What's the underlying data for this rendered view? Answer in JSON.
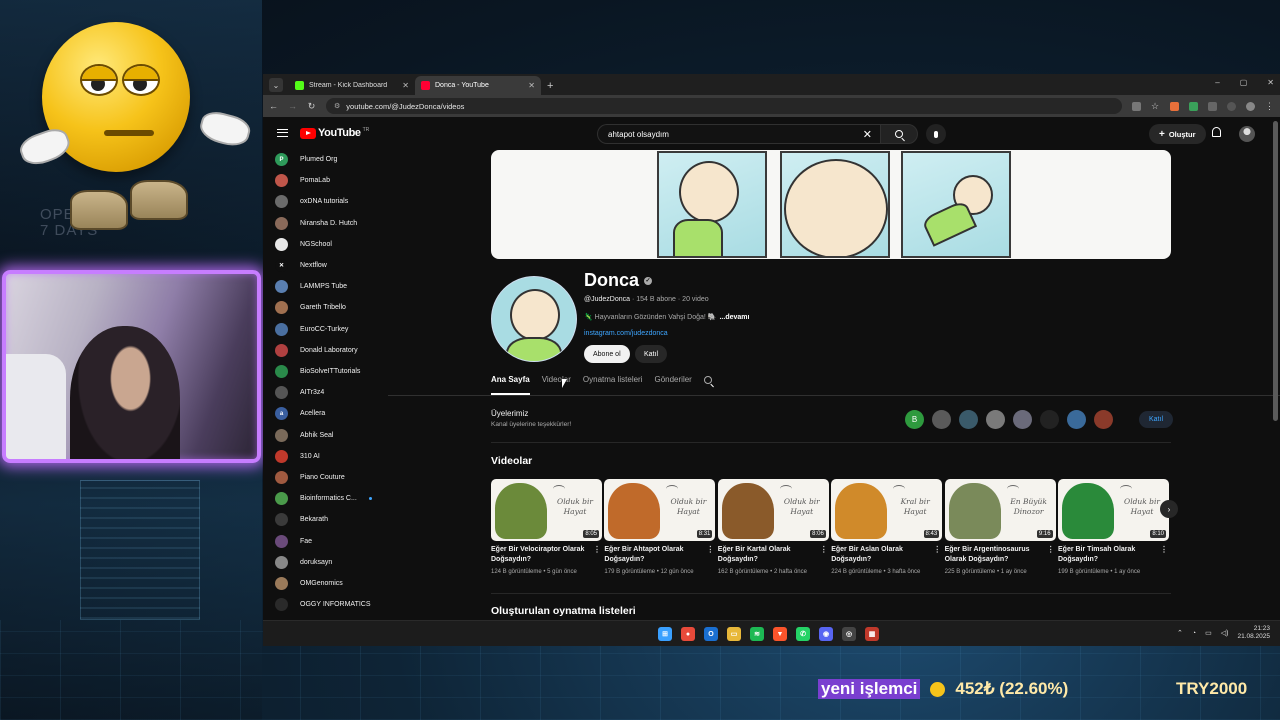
{
  "overlay": {
    "open_text_1": "OPE",
    "open_text_2": "7 DAYS",
    "ticker_highlight": "yeni işlemci",
    "ticker_value": "452₺ (22.60%)",
    "ticker_right": "TRY2000"
  },
  "browser": {
    "tabs": [
      {
        "label": "Stream - Kick Dashboard",
        "favicon_color": "#53fc18",
        "active": false
      },
      {
        "label": "Donca - YouTube",
        "favicon_color": "#ff0033",
        "active": true
      }
    ],
    "url": "youtube.com/@JudezDonca/videos",
    "window_controls": [
      "–",
      "▢",
      "✕"
    ]
  },
  "youtube": {
    "logo_text": "YouTube",
    "logo_sup": "TR",
    "search_value": "ahtapot olsaydım",
    "create_label": "Oluştur",
    "sidebar": [
      {
        "label": "Plumed Org",
        "color": "#2e9a5a",
        "initial": "P"
      },
      {
        "label": "PomaLab",
        "color": "#c0564a",
        "initial": ""
      },
      {
        "label": "oxDNA tutorials",
        "color": "#6b6b6b",
        "initial": ""
      },
      {
        "label": "Niransha D. Hutch",
        "color": "#8a6a5a",
        "initial": ""
      },
      {
        "label": "NGSchool",
        "color": "#e8e8e8",
        "initial": ""
      },
      {
        "label": "Nextflow",
        "color": "#0f0f0f",
        "initial": "✕"
      },
      {
        "label": "LAMMPS Tube",
        "color": "#5a7fb0",
        "initial": ""
      },
      {
        "label": "Gareth Tribello",
        "color": "#a07050",
        "initial": ""
      },
      {
        "label": "EuroCC-Turkey",
        "color": "#4a6fa0",
        "initial": ""
      },
      {
        "label": "Donald Laboratory",
        "color": "#b04040",
        "initial": ""
      },
      {
        "label": "BioSolveITTutorials",
        "color": "#2a8a4a",
        "initial": ""
      },
      {
        "label": "AITr3z4",
        "color": "#555",
        "initial": ""
      },
      {
        "label": "Acellera",
        "color": "#3a5fa0",
        "initial": "a"
      },
      {
        "label": "Abhik Seal",
        "color": "#7a6a5a",
        "initial": ""
      },
      {
        "label": "310 AI",
        "color": "#c0392b",
        "initial": ""
      },
      {
        "label": "Piano Couture",
        "color": "#a05a40",
        "initial": ""
      },
      {
        "label": "Bioinformatics C...",
        "color": "#4a9a4a",
        "initial": "",
        "new": true
      },
      {
        "label": "Bekarath",
        "color": "#3a3a3a",
        "initial": ""
      },
      {
        "label": "Fae",
        "color": "#6a4a7a",
        "initial": ""
      },
      {
        "label": "doruksayn",
        "color": "#888",
        "initial": ""
      },
      {
        "label": "OMGenomics",
        "color": "#9a7a5a",
        "initial": ""
      },
      {
        "label": "OGGY INFORMATICS",
        "color": "#2a2a2a",
        "initial": ""
      }
    ],
    "channel": {
      "name": "Donca",
      "handle": "@JudezDonca",
      "meta": " · 154 B abone · 20 video",
      "description": "🦎 Hayvanların Gözünden Vahşi Doğa! 🐘",
      "more": "...devamı",
      "link": "instagram.com/judezdonca",
      "subscribe_label": "Abone ol",
      "join_label": "Katıl"
    },
    "channel_tabs": [
      "Ana Sayfa",
      "Videolar",
      "Oynatma listeleri",
      "Gönderiler"
    ],
    "active_tab_index": 0,
    "members": {
      "title": "Üyelerimiz",
      "subtitle": "Kanal üyelerine teşekkürler!",
      "join_label": "Katıl",
      "avatars": [
        {
          "initial": "B",
          "color": "#2e9a3e"
        },
        {
          "initial": "",
          "color": "#5a5a5a"
        },
        {
          "initial": "",
          "color": "#3a5a6a"
        },
        {
          "initial": "",
          "color": "#7a7a7a"
        },
        {
          "initial": "",
          "color": "#6a6a7a"
        },
        {
          "initial": "",
          "color": "#222"
        },
        {
          "initial": "",
          "color": "#3a6a9a"
        },
        {
          "initial": "",
          "color": "#8a3a2a"
        }
      ]
    },
    "videos_title": "Videolar",
    "videos": [
      {
        "title": "Eğer Bir Velociraptor Olarak Doğsaydın?",
        "views": "124 B görüntüleme",
        "age": "5 gün önce",
        "duration": "8:05",
        "hand_text": "Olduk bir Hayat",
        "creature_color": "#6b8a3a"
      },
      {
        "title": "Eğer Bir Ahtapot Olarak Doğsaydın?",
        "views": "179 B görüntüleme",
        "age": "12 gün önce",
        "duration": "8:31",
        "hand_text": "Olduk bir Hayat",
        "creature_color": "#c06a2a"
      },
      {
        "title": "Eğer Bir Kartal Olarak Doğsaydın?",
        "views": "162 B görüntüleme",
        "age": "2 hafta önce",
        "duration": "8:06",
        "hand_text": "Olduk bir Hayat",
        "creature_color": "#8a5a2a"
      },
      {
        "title": "Eğer Bir Aslan Olarak Doğsaydın?",
        "views": "224 B görüntüleme",
        "age": "3 hafta önce",
        "duration": "8:43",
        "hand_text": "Kral bir Hayat",
        "creature_color": "#d08a2a"
      },
      {
        "title": "Eğer Bir Argentinosaurus Olarak Doğsaydın?",
        "views": "225 B görüntüleme",
        "age": "1 ay önce",
        "duration": "9:16",
        "hand_text": "En Büyük Dinozor",
        "creature_color": "#7a8a5a"
      },
      {
        "title": "Eğer Bir Timsah Olarak Doğsaydın?",
        "views": "199 B görüntüleme",
        "age": "1 ay önce",
        "duration": "8:10",
        "hand_text": "Olduk bir Hayat",
        "creature_color": "#2a8a3a"
      }
    ],
    "playlists_title": "Oluşturulan oynatma listeleri"
  },
  "taskbar": {
    "icons": [
      {
        "name": "windows-start-icon",
        "color": "#3aa0ff",
        "glyph": "⊞"
      },
      {
        "name": "chrome-icon",
        "color": "#e84a3a",
        "glyph": "●"
      },
      {
        "name": "outlook-icon",
        "color": "#1a6fd0",
        "glyph": "O"
      },
      {
        "name": "file-explorer-icon",
        "color": "#e8b83a",
        "glyph": "▭"
      },
      {
        "name": "spotify-icon",
        "color": "#1db954",
        "glyph": "≋"
      },
      {
        "name": "brave-icon",
        "color": "#fb542b",
        "glyph": "▼"
      },
      {
        "name": "whatsapp-icon",
        "color": "#25d366",
        "glyph": "✆"
      },
      {
        "name": "discord-icon",
        "color": "#5865f2",
        "glyph": "◉"
      },
      {
        "name": "obs-icon",
        "color": "#444",
        "glyph": "◎"
      },
      {
        "name": "calendar-icon",
        "color": "#c0392b",
        "glyph": "▦"
      }
    ],
    "time": "21:23",
    "date": "21.08.2025"
  }
}
